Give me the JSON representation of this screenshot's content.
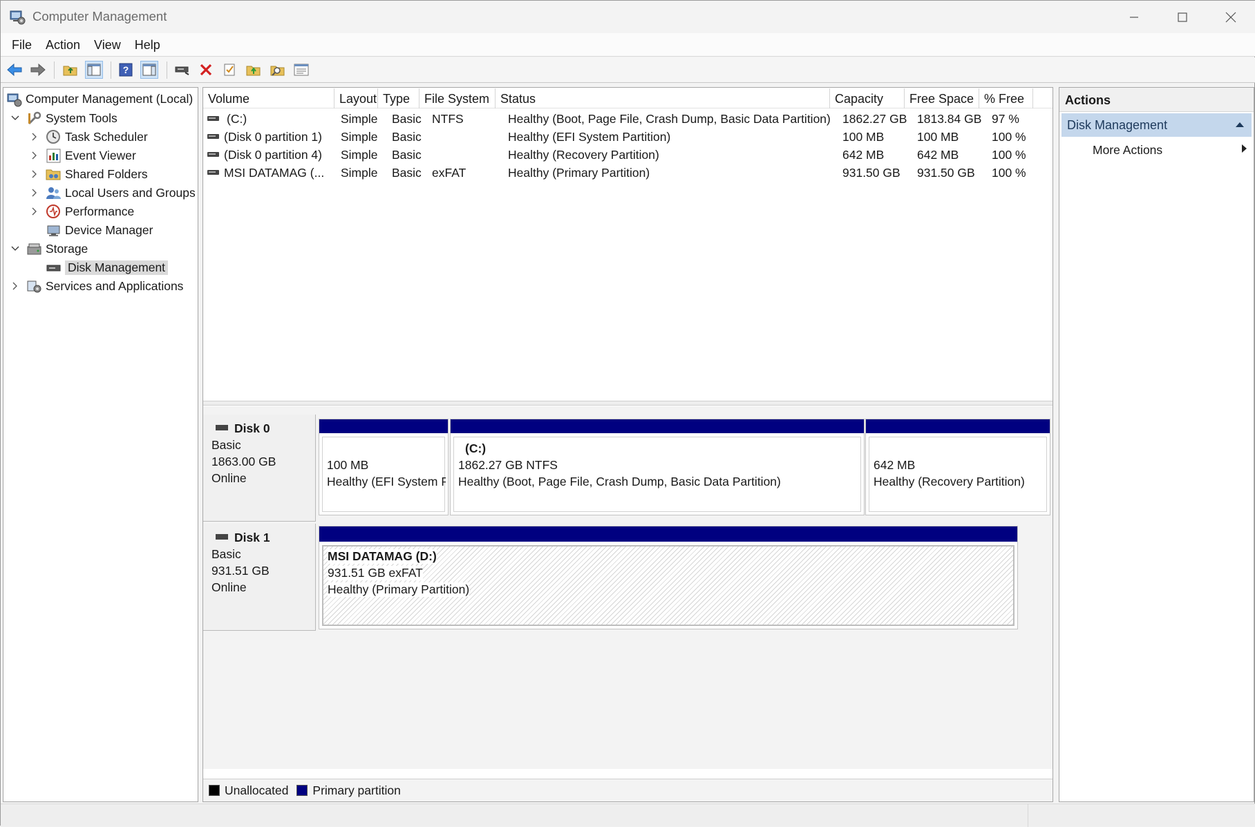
{
  "window": {
    "title": "Computer Management"
  },
  "menu": [
    "File",
    "Action",
    "View",
    "Help"
  ],
  "tree": {
    "root": "Computer Management (Local)",
    "system_tools": "System Tools",
    "task_scheduler": "Task Scheduler",
    "event_viewer": "Event Viewer",
    "shared_folders": "Shared Folders",
    "local_users": "Local Users and Groups",
    "performance": "Performance",
    "device_manager": "Device Manager",
    "storage": "Storage",
    "disk_management": "Disk Management",
    "services": "Services and Applications"
  },
  "list": {
    "headers": {
      "volume": "Volume",
      "layout": "Layout",
      "type": "Type",
      "fs": "File System",
      "status": "Status",
      "capacity": "Capacity",
      "free": "Free Space",
      "pct": "% Free"
    },
    "rows": [
      {
        "volume": "(C:)",
        "layout": "Simple",
        "type": "Basic",
        "fs": "NTFS",
        "status": "Healthy (Boot, Page File, Crash Dump, Basic Data Partition)",
        "capacity": "1862.27 GB",
        "free": "1813.84 GB",
        "pct": "97 %"
      },
      {
        "volume": "(Disk 0 partition 1)",
        "layout": "Simple",
        "type": "Basic",
        "fs": "",
        "status": "Healthy (EFI System Partition)",
        "capacity": "100 MB",
        "free": "100 MB",
        "pct": "100 %"
      },
      {
        "volume": "(Disk 0 partition 4)",
        "layout": "Simple",
        "type": "Basic",
        "fs": "",
        "status": "Healthy (Recovery Partition)",
        "capacity": "642 MB",
        "free": "642 MB",
        "pct": "100 %"
      },
      {
        "volume": "MSI DATAMAG (...",
        "layout": "Simple",
        "type": "Basic",
        "fs": "exFAT",
        "status": "Healthy (Primary Partition)",
        "capacity": "931.50 GB",
        "free": "931.50 GB",
        "pct": "100 %"
      }
    ]
  },
  "disks": {
    "disk0": {
      "name": "Disk 0",
      "kind": "Basic",
      "size": "1863.00 GB",
      "state": "Online",
      "p1": {
        "size": "100 MB",
        "status": "Healthy (EFI System P"
      },
      "p2": {
        "label": "(C:)",
        "size": "1862.27 GB NTFS",
        "status": "Healthy (Boot, Page File, Crash Dump, Basic Data Partition)"
      },
      "p3": {
        "size": "642 MB",
        "status": "Healthy (Recovery Partition)"
      }
    },
    "disk1": {
      "name": "Disk 1",
      "kind": "Basic",
      "size": "931.51 GB",
      "state": "Online",
      "p1": {
        "label": "MSI DATAMAG  (D:)",
        "size": "931.51 GB exFAT",
        "status": "Healthy (Primary Partition)"
      }
    }
  },
  "legend": {
    "unallocated": "Unallocated",
    "primary": "Primary partition"
  },
  "actions": {
    "header": "Actions",
    "section": "Disk Management",
    "more": "More Actions"
  },
  "colors": {
    "partition_bar": "#000080",
    "actions_selected": "#c4d7ec",
    "unallocated": "#000000"
  }
}
